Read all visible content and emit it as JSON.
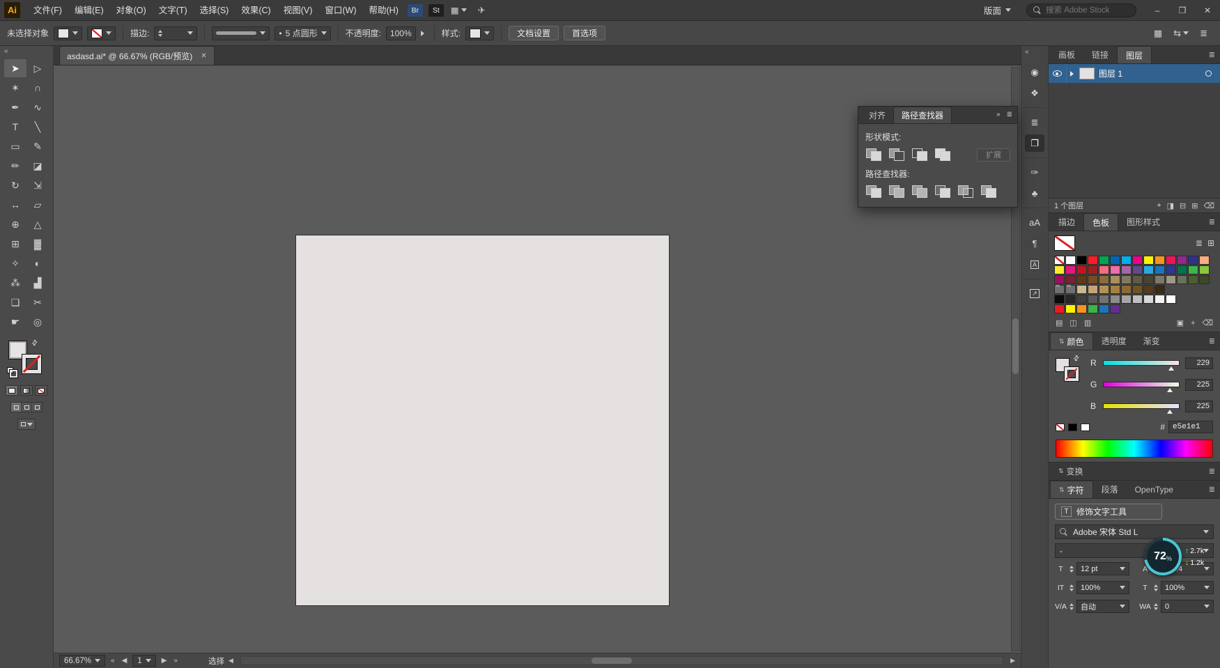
{
  "colors": {
    "artboard_fill": "#e5e1e1",
    "selection_blue": "#31618e"
  },
  "window": {
    "minimize": "–",
    "maximize": "❐",
    "close": "✕"
  },
  "icons": {
    "menu": "≣",
    "double_chevron_left": "«",
    "double_chevron_right": "»",
    "panel_collapse": "⇅",
    "swap": "⇄",
    "list_view": "≣",
    "grid_view": "⊞",
    "arrange_docs": "▦",
    "workspace_switch": "⇆",
    "workspace_grid": "▦",
    "wing": "✈",
    "up_arrow": "↑",
    "down_arrow": "↓",
    "nav_first": "«",
    "nav_prev": "◀",
    "nav_next": "▶",
    "nav_last": "»",
    "scroll_left": "◀",
    "scroll_right": "▶",
    "touch_tool": "T"
  },
  "menubar": {
    "logo": "Ai",
    "items": [
      "文件(F)",
      "编辑(E)",
      "对象(O)",
      "文字(T)",
      "选择(S)",
      "效果(C)",
      "视图(V)",
      "窗口(W)",
      "帮助(H)"
    ],
    "bridge_badge": "Br",
    "stock_badge": "St",
    "workspace_menu_label": "版面",
    "search_placeholder": "搜索 Adobe Stock"
  },
  "controlbar": {
    "selection_status": "未选择对象",
    "stroke_label": "描边:",
    "brush_bullet": "•",
    "brush_name": "5 点圆形",
    "opacity_label": "不透明度:",
    "opacity_value": "100%",
    "style_label": "样式:",
    "document_setup_label": "文档设置",
    "preferences_label": "首选项"
  },
  "doc_tab": {
    "title": "asdasd.ai* @ 66.67% (RGB/预览)",
    "close": "✕"
  },
  "tools": [
    {
      "name": "selection-tool",
      "glyph": "➤",
      "active": true
    },
    {
      "name": "direct-selection-tool",
      "glyph": "▷"
    },
    {
      "name": "magic-wand-tool",
      "glyph": "✶"
    },
    {
      "name": "lasso-tool",
      "glyph": "∩"
    },
    {
      "name": "pen-tool",
      "glyph": "✒"
    },
    {
      "name": "curvature-tool",
      "glyph": "∿"
    },
    {
      "name": "type-tool",
      "glyph": "T"
    },
    {
      "name": "line-segment-tool",
      "glyph": "╲"
    },
    {
      "name": "rectangle-tool",
      "glyph": "▭"
    },
    {
      "name": "paintbrush-tool",
      "glyph": "✎"
    },
    {
      "name": "pencil-tool",
      "glyph": "✏"
    },
    {
      "name": "eraser-tool",
      "glyph": "◪"
    },
    {
      "name": "rotate-tool",
      "glyph": "↻"
    },
    {
      "name": "scale-tool",
      "glyph": "⇲"
    },
    {
      "name": "width-tool",
      "glyph": "↔"
    },
    {
      "name": "free-transform-tool",
      "glyph": "▱"
    },
    {
      "name": "shape-builder-tool",
      "glyph": "⊕"
    },
    {
      "name": "perspective-grid-tool",
      "glyph": "△"
    },
    {
      "name": "mesh-tool",
      "glyph": "⊞"
    },
    {
      "name": "gradient-tool",
      "glyph": "▓"
    },
    {
      "name": "eyedropper-tool",
      "glyph": "✧"
    },
    {
      "name": "blend-tool",
      "glyph": "◐"
    },
    {
      "name": "symbol-sprayer-tool",
      "glyph": "⁂"
    },
    {
      "name": "column-graph-tool",
      "glyph": "▟"
    },
    {
      "name": "artboard-tool",
      "glyph": "❏"
    },
    {
      "name": "slice-tool",
      "glyph": "✂"
    },
    {
      "name": "hand-tool",
      "glyph": "☛"
    },
    {
      "name": "zoom-tool",
      "glyph": "◎"
    }
  ],
  "pathfinder": {
    "tabs": [
      "对齐",
      "路径查找器"
    ],
    "shape_mode_label": "形状模式:",
    "expand_label": "扩展",
    "pathfinder_label": "路径查找器:",
    "shape_modes": [
      "unite",
      "minus-front",
      "intersect",
      "exclude"
    ],
    "pathfinders": [
      "divide",
      "trim",
      "merge",
      "crop",
      "outline",
      "minus-back"
    ]
  },
  "dock": {
    "groups": [
      [
        {
          "name": "color-panel-icon",
          "glyph": "◉"
        },
        {
          "name": "color-guide-icon",
          "glyph": "❖"
        }
      ],
      [
        {
          "name": "stroke-panel-icon",
          "glyph": "≣"
        },
        {
          "name": "pathfinder-panel-icon",
          "glyph": "❐",
          "active": true
        }
      ],
      [
        {
          "name": "brushes-panel-icon",
          "glyph": "✑"
        },
        {
          "name": "symbols-panel-icon",
          "glyph": "♣"
        }
      ],
      [
        {
          "name": "character-styles-icon",
          "glyph": "aA"
        },
        {
          "name": "paragraph-styles-icon",
          "glyph": "¶"
        },
        {
          "name": "glyphs-panel-icon",
          "glyph": "A",
          "boxed": true
        }
      ],
      [
        {
          "name": "export-panel-icon",
          "glyph": "↗",
          "boxed": true
        }
      ]
    ]
  },
  "panels": {
    "top_tabs": [
      "画板",
      "链接",
      "图层"
    ],
    "layers": {
      "layer_name": "图层 1",
      "count_label": "1 个图层",
      "footer_icons": [
        {
          "name": "locate-object-icon",
          "glyph": "⌖"
        },
        {
          "name": "clipping-mask-icon",
          "glyph": "◨"
        },
        {
          "name": "new-sublayer-icon",
          "glyph": "⊟"
        },
        {
          "name": "new-layer-icon",
          "glyph": "⊞"
        },
        {
          "name": "delete-layer-icon",
          "glyph": "⌫"
        }
      ]
    },
    "swatch_tabs": [
      "描边",
      "色板",
      "图形样式"
    ],
    "swatches": {
      "rows": [
        [
          "none",
          "#ffffff",
          "#000000",
          "#ff1d25",
          "#00a651",
          "#0066b3",
          "#00aeef",
          "#ec008c",
          "#fff200",
          "#f7941d",
          "#ed145b",
          "#92278f",
          "#2e3192",
          "#f9ad81"
        ],
        [
          "#fde92c",
          "#e6177d",
          "#c2151e",
          "#a01e20",
          "#f26d7d",
          "#f06eaa",
          "#a864a8",
          "#5f4b8b",
          "#27aae1",
          "#1c75bc",
          "#2b388f",
          "#00734d",
          "#3cb54a",
          "#8dc63f"
        ],
        [
          "#9c0f5f",
          "#76232f",
          "#603913",
          "#754c24",
          "#8a6d3b",
          "#a8905f",
          "#7f7a5e",
          "#5e5a45",
          "#474433",
          "#7c7969",
          "#9d9787",
          "#6b705c",
          "#4f5d2f",
          "#3e4826"
        ],
        [
          "group",
          "group",
          "#cdb891",
          "#c2a578",
          "#b59157",
          "#a87f3f",
          "#8c6a32",
          "#6f5226",
          "#553b1c",
          "#3b2a13"
        ],
        [
          "#0a0a0a",
          "#262626",
          "#404040",
          "#595959",
          "#737373",
          "#8c8c8c",
          "#a6a6a6",
          "#bfbfbf",
          "#d9d9d9",
          "#f2f2f2",
          "#ffffff"
        ],
        [
          "#ed1c24",
          "#fff200",
          "#f7941d",
          "#3cb54a",
          "#1c75bc",
          "#662d91"
        ]
      ],
      "footer_icons": [
        {
          "name": "swatch-libraries-icon",
          "glyph": "▤"
        },
        {
          "name": "swatch-themes-icon",
          "glyph": "◫"
        },
        {
          "name": "swatch-kinds-icon",
          "glyph": "▥"
        },
        {
          "name": "new-color-group-icon",
          "glyph": "▣",
          "right": true
        },
        {
          "name": "new-swatch-icon",
          "glyph": "+"
        },
        {
          "name": "delete-swatch-icon",
          "glyph": "⌫"
        }
      ]
    },
    "color_tabs": [
      "颜色",
      "透明度",
      "渐变"
    ],
    "color": {
      "r_label": "R",
      "g_label": "G",
      "b_label": "B",
      "r_value": "229",
      "g_value": "225",
      "b_value": "225",
      "r_gradient": [
        "#00e1e1",
        "#ffe1e1"
      ],
      "g_gradient": [
        "#e500e1",
        "#e5ffe1"
      ],
      "b_gradient": [
        "#e5e100",
        "#e5e1ff"
      ],
      "hex_hash": "#",
      "hex_value": "e5e1e1"
    },
    "transform_label": "变换",
    "char_tabs": [
      "字符",
      "段落",
      "OpenType"
    ],
    "character": {
      "touch_tool_label": "修饰文字工具",
      "font_name": "Adobe 宋体 Std L",
      "font_style": "-",
      "font_size": "12 pt",
      "leading": "(14.4 ",
      "vertical_scale": "100%",
      "horizontal_scale": "100%",
      "kerning": "自动",
      "tracking": "0"
    },
    "character_icons": {
      "size": "T",
      "leading": "A",
      "v_scale": "IT",
      "h_scale": "T",
      "kerning": "V/A",
      "tracking": "WA"
    }
  },
  "statusbar": {
    "zoom": "66.67%",
    "artboard_number": "1",
    "status_text": "选择"
  },
  "gauge": {
    "percent": "72",
    "unit": "%",
    "up_value": "2.7k",
    "down_value": "1.2k"
  }
}
